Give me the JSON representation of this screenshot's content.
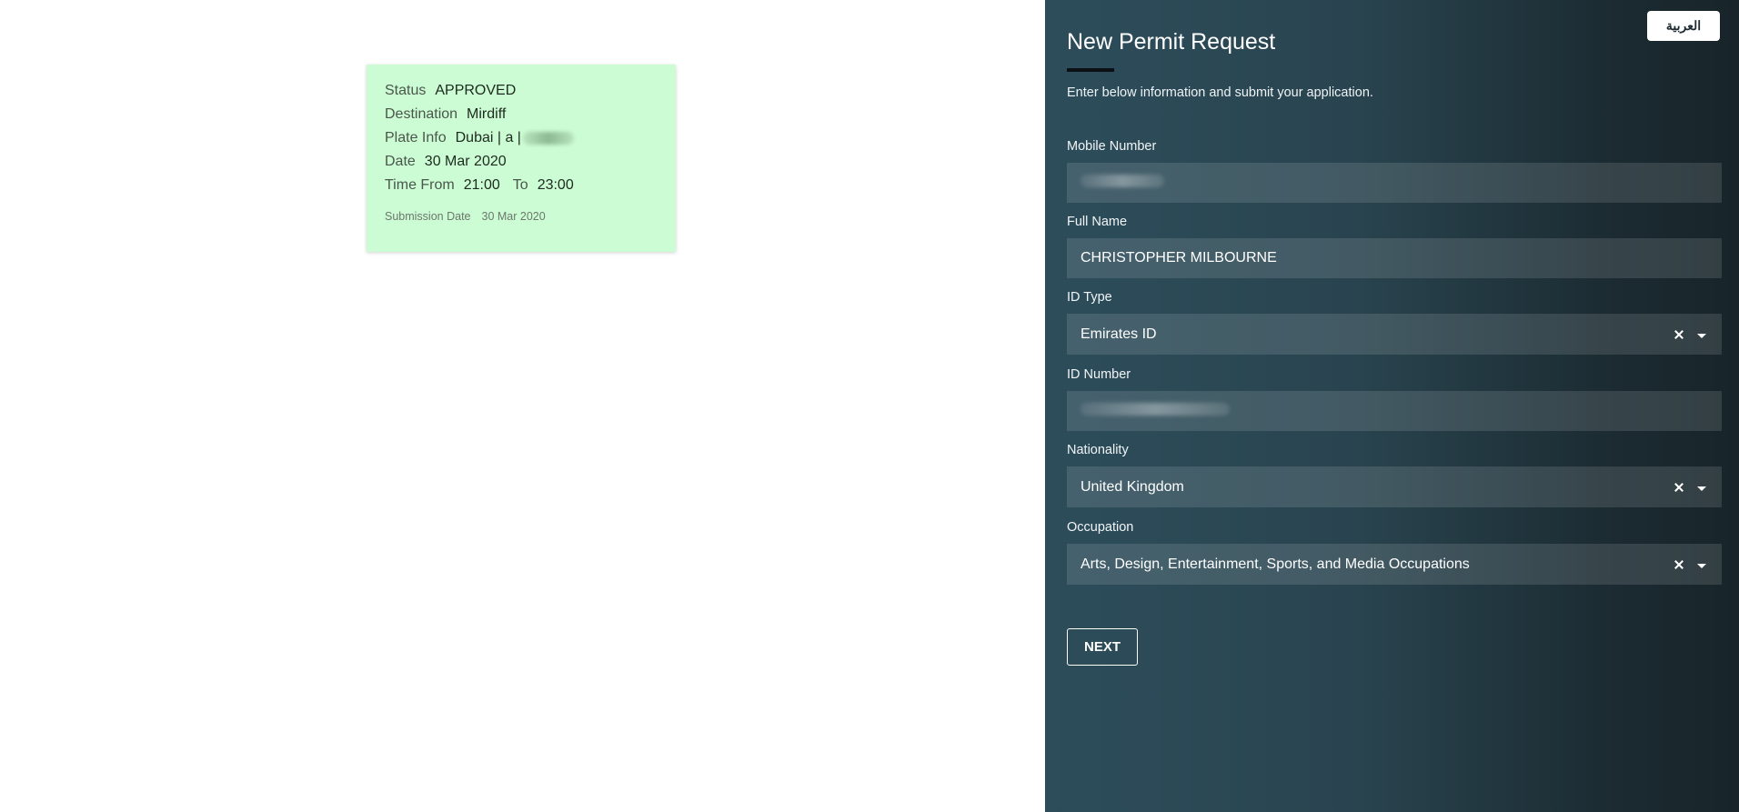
{
  "permit_card": {
    "status_label": "Status",
    "status_value": "APPROVED",
    "destination_label": "Destination",
    "destination_value": "Mirdiff",
    "plate_label": "Plate Info",
    "plate_value": "Dubai | a |",
    "date_label": "Date",
    "date_value": "30 Mar 2020",
    "time_from_label": "Time From",
    "time_from_value": "21:00",
    "time_to_label": "To",
    "time_to_value": "23:00",
    "submission_label": "Submission Date",
    "submission_value": "30 Mar 2020",
    "background_color": "#ccfcd3"
  },
  "form": {
    "language_button": "العربية",
    "title": "New Permit Request",
    "subtitle": "Enter below information and submit your application.",
    "fields": {
      "mobile": {
        "label": "Mobile Number",
        "value": ""
      },
      "full_name": {
        "label": "Full Name",
        "value": "CHRISTOPHER MILBOURNE"
      },
      "id_type": {
        "label": "ID Type",
        "value": "Emirates ID"
      },
      "id_number": {
        "label": "ID Number",
        "value": ""
      },
      "nationality": {
        "label": "Nationality",
        "value": "United Kingdom"
      },
      "occupation": {
        "label": "Occupation",
        "value": "Arts, Design, Entertainment, Sports, and Media Occupations"
      }
    },
    "next_button": "NEXT",
    "colors": {
      "panel_start": "#2d4d5b",
      "panel_end": "#182429",
      "accent_bar": "#0b1014"
    },
    "icons": {
      "clear": "close-icon",
      "dropdown": "chevron-down-icon"
    }
  }
}
